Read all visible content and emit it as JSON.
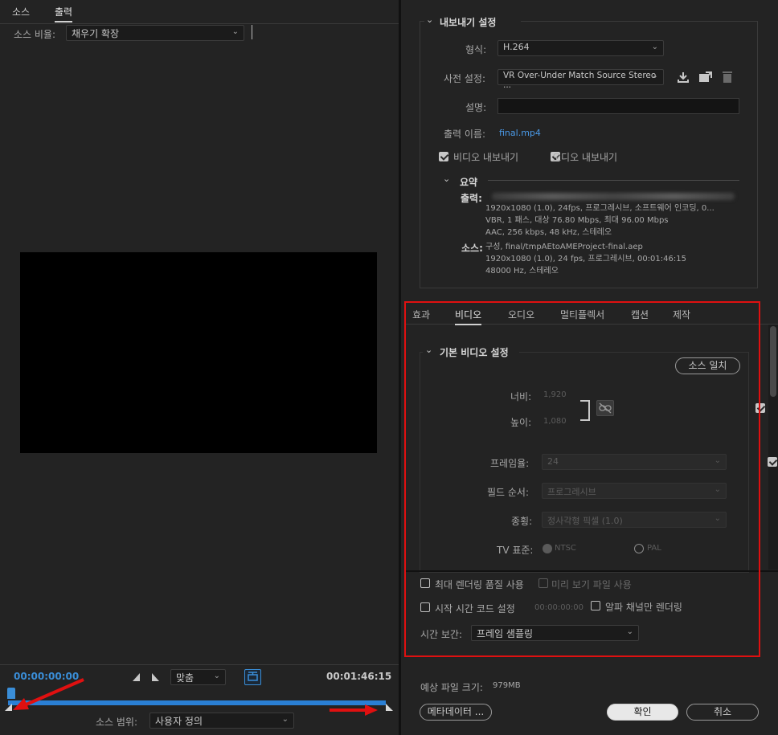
{
  "left": {
    "tabs": [
      {
        "label": "소스",
        "active": false
      },
      {
        "label": "출력",
        "active": true
      }
    ],
    "source_scale_label": "소스 비율:",
    "source_scale_value": "채우기 확장",
    "timecode_start": "00:00:00:00",
    "timecode_end": "00:01:46:15",
    "fit_value": "맞춤",
    "source_range_label": "소스 범위:",
    "source_range_value": "사용자 정의"
  },
  "export_settings": {
    "section_title": "내보내기 설정",
    "format_label": "형식:",
    "format_value": "H.264",
    "preset_label": "사전 설정:",
    "preset_value": "VR Over-Under Match Source Stereo ...",
    "comment_label": "설명:",
    "comment_value": "",
    "output_name_label": "출력 이름:",
    "output_name_value": "final.mp4",
    "export_video_label": "비디오 내보내기",
    "export_video_checked": true,
    "export_audio_label": "오디오 내보내기",
    "export_audio_checked": true
  },
  "summary": {
    "title": "요약",
    "output_label": "출력:",
    "output_lines": [
      "1920x1080 (1.0), 24fps, 프로그레시브, 소프트웨어 인코딩, 0...",
      "VBR, 1 패스, 대상 76.80 Mbps, 최대  96.00 Mbps",
      "AAC, 256 kbps, 48 kHz, 스테레오"
    ],
    "source_label": "소스:",
    "source_lines": [
      "구성, final/tmpAEtoAMEProject-final.aep",
      "1920x1080 (1.0), 24 fps, 프로그레시브, 00:01:46:15",
      "48000 Hz, 스테레오"
    ]
  },
  "tabs": [
    {
      "label": "효과",
      "active": false
    },
    {
      "label": "비디오",
      "active": true
    },
    {
      "label": "오디오",
      "active": false
    },
    {
      "label": "멀티플렉서",
      "active": false
    },
    {
      "label": "캡션",
      "active": false
    },
    {
      "label": "제작",
      "active": false
    }
  ],
  "basic_video": {
    "section_title": "기본 비디오 설정",
    "match_source_label": "소스 일치",
    "width_label": "너비:",
    "width_value": "1,920",
    "height_label": "높이:",
    "height_value": "1,080",
    "framerate_label": "프레임율:",
    "framerate_value": "24",
    "field_order_label": "필드 순서:",
    "field_order_value": "프로그레시브",
    "aspect_label": "종횡:",
    "aspect_value": "정사각형 픽셀 (1.0)",
    "tv_standard_label": "TV 표준:",
    "tv_ntsc": "NTSC",
    "tv_pal": "PAL"
  },
  "bottom_options": {
    "max_render_quality": "최대 렌더링 품질 사용",
    "use_previews": "미리 보기 파일 사용",
    "set_start_timecode": "시작 시간 코드 설정",
    "start_timecode_value": "00:00:00:00",
    "render_alpha_only": "알파 채널만 렌더링",
    "time_interp_label": "시간 보간:",
    "time_interp_value": "프레임 샘플링"
  },
  "footer": {
    "estimated_size_label": "예상 파일 크기:",
    "estimated_size_value": "979MB",
    "metadata_button": "메타데이터 ...",
    "ok_button": "확인",
    "cancel_button": "취소"
  },
  "colors": {
    "accent_blue": "#2a7fd4",
    "highlight_red": "#e01010",
    "link_blue": "#3a8ed8"
  }
}
